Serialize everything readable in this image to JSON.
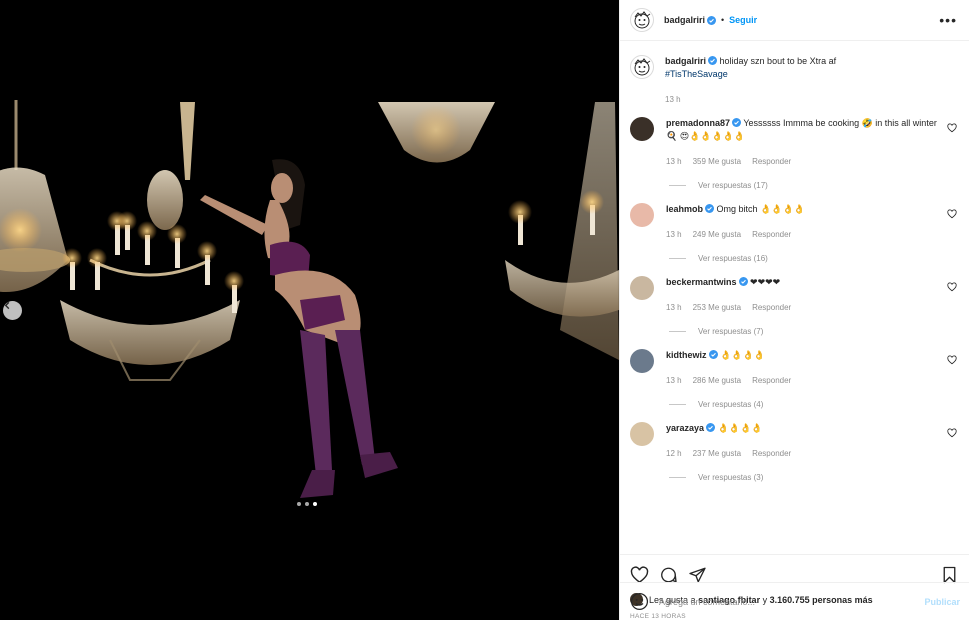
{
  "post": {
    "author": "badgalriri",
    "follow_label": "Seguir",
    "separator": "•",
    "more_label": "•••"
  },
  "caption": {
    "username": "badgalriri",
    "text": "holiday szn bout to be Xtra af",
    "hashtag": "#TisTheSavage",
    "time": "13 h"
  },
  "comments": [
    {
      "username": "premadonna87",
      "verified": true,
      "text": "Yessssss Immma be cooking 🤣 in this all winter 🍳 😍👌👌👌👌👌",
      "time": "13 h",
      "likes": "359 Me gusta",
      "reply_label": "Responder",
      "replies": "Ver respuestas (17)",
      "avatar_color": "#3a3028"
    },
    {
      "username": "leahmob",
      "verified": true,
      "text": "Omg bitch 👌👌👌👌",
      "time": "13 h",
      "likes": "249 Me gusta",
      "reply_label": "Responder",
      "replies": "Ver respuestas (16)",
      "avatar_color": "#e8b9a8"
    },
    {
      "username": "beckermantwins",
      "verified": true,
      "text": "❤❤❤❤",
      "time": "13 h",
      "likes": "253 Me gusta",
      "reply_label": "Responder",
      "replies": "Ver respuestas (7)",
      "avatar_color": "#c9b7a0"
    },
    {
      "username": "kidthewiz",
      "verified": true,
      "text": "👌👌👌👌",
      "time": "13 h",
      "likes": "286 Me gusta",
      "reply_label": "Responder",
      "replies": "Ver respuestas (4)",
      "avatar_color": "#6b7a8c"
    },
    {
      "username": "yarazaya",
      "verified": true,
      "text": "👌👌👌👌",
      "time": "12 h",
      "likes": "237 Me gusta",
      "reply_label": "Responder",
      "replies": "Ver respuestas (3)",
      "avatar_color": "#d8c3a4"
    }
  ],
  "likes": {
    "prefix": "Les gusta a",
    "user": "santiago.fbitar",
    "middle": "y",
    "count": "3.160.755 personas más"
  },
  "time_ago": "HACE 13 HORAS",
  "composer": {
    "placeholder": "Agrega un comentario...",
    "publish_label": "Publicar"
  },
  "colors": {
    "accent": "#0095f6",
    "verified": "#3897f0",
    "heart": "#ed4956"
  }
}
